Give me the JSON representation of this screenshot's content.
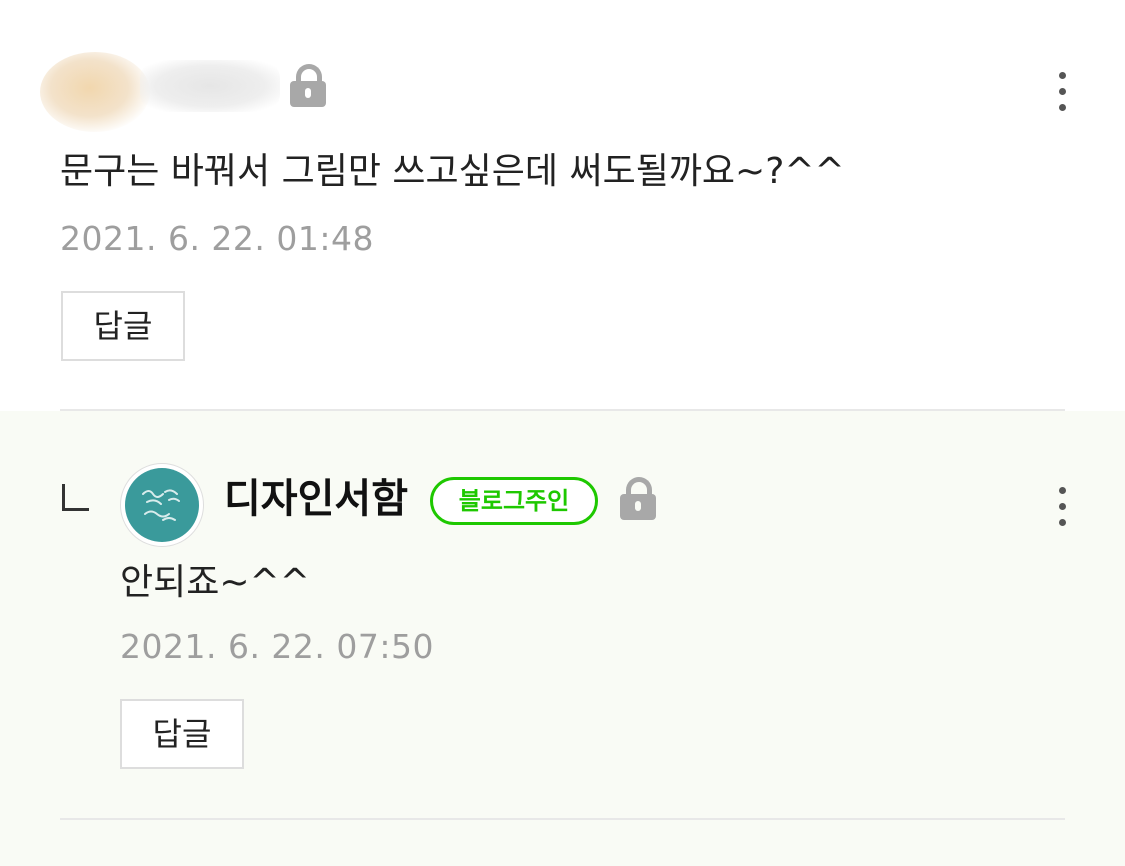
{
  "comments": [
    {
      "text": "문구는 바꿔서 그림만 쓰고싶은데 써도될까요~?^^",
      "date": "2021. 6. 22. 01:48",
      "reply_label": "답글",
      "author_blurred": true,
      "locked": true
    },
    {
      "author": "디자인서함",
      "badge": "블로그주인",
      "text": "안되죠~^^",
      "date": "2021. 6. 22. 07:50",
      "reply_label": "답글",
      "locked": true,
      "is_reply": true
    }
  ],
  "colors": {
    "owner_badge": "#1ec800",
    "reply_background": "#f9fbf5",
    "date_text": "#9e9e9e",
    "lock_icon": "#a8a8a8"
  },
  "icons": [
    "lock-icon",
    "more-vertical-icon",
    "reply-arrow-icon"
  ]
}
